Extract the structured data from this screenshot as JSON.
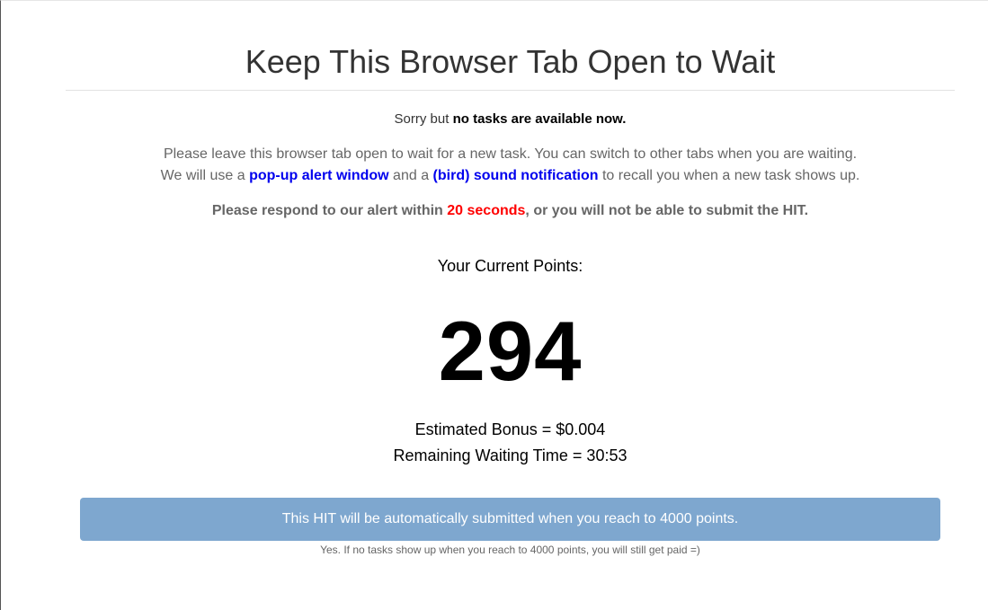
{
  "header": {
    "title": "Keep This Browser Tab Open to Wait"
  },
  "notice": {
    "sorry_prefix": "Sorry but ",
    "sorry_bold": "no tasks are available now.",
    "line1": "Please leave this browser tab open to wait for a new task. You can switch to other tabs when you are waiting.",
    "line2_a": "We will use a ",
    "line2_link1": "pop-up alert window",
    "line2_b": " and a ",
    "line2_link2": "(bird) sound notification",
    "line2_c": " to recall you when a new task shows up.",
    "respond_a": "Please respond to our alert within ",
    "respond_time": "20 seconds",
    "respond_b": ", or you will not be able to submit the HIT."
  },
  "points": {
    "label": "Your Current Points:",
    "value": "294",
    "bonus": "Estimated Bonus = $0.004",
    "remaining": "Remaining Waiting Time = 30:53"
  },
  "banner": {
    "text": "This HIT will be automatically submitted when you reach to 4000 points.",
    "footnote": "Yes. If no tasks show up when you reach to 4000 points, you will still get paid =)"
  },
  "colors": {
    "link_blue": "#0000ee",
    "alert_red": "#ff0000",
    "banner_bg": "#7ea7cf"
  }
}
